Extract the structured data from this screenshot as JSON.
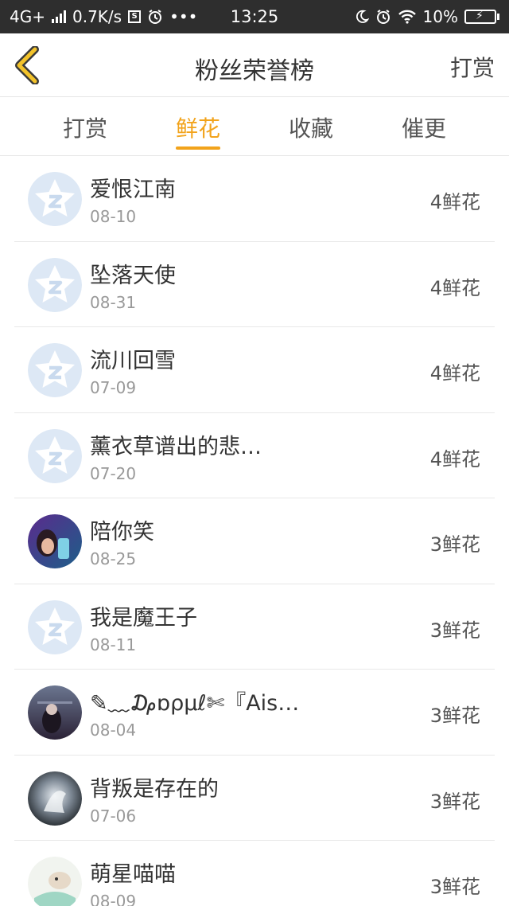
{
  "status_bar": {
    "network": "4G+",
    "speed": "0.7K/s",
    "time": "13:25",
    "battery": "10%",
    "icons": [
      "signal-icon",
      "s-box-icon",
      "alarm-icon",
      "more-icon",
      "moon-icon",
      "alarm-icon",
      "wifi-icon",
      "battery-icon"
    ]
  },
  "header": {
    "title": "粉丝荣誉榜",
    "back_icon": "chevron-left-icon",
    "right_action": "打赏"
  },
  "tabs": [
    {
      "label": "打赏",
      "active": false
    },
    {
      "label": "鲜花",
      "active": true
    },
    {
      "label": "收藏",
      "active": false
    },
    {
      "label": "催更",
      "active": false
    }
  ],
  "fans": [
    {
      "name": "爱恨江南",
      "date": "08-10",
      "amount": "4鲜花",
      "avatar": "default-avatar"
    },
    {
      "name": "坠落天使",
      "date": "08-31",
      "amount": "4鲜花",
      "avatar": "default-avatar"
    },
    {
      "name": "流川回雪",
      "date": "07-09",
      "amount": "4鲜花",
      "avatar": "default-avatar"
    },
    {
      "name": "薰衣草谱出的悲…",
      "date": "07-20",
      "amount": "4鲜花",
      "avatar": "default-avatar"
    },
    {
      "name": "陪你笑",
      "date": "08-25",
      "amount": "3鲜花",
      "avatar": "photo-avatar"
    },
    {
      "name": "我是魔王子",
      "date": "08-11",
      "amount": "3鲜花",
      "avatar": "default-avatar"
    },
    {
      "name": "✎﹏₯ɒρμℓ✄『Ais…",
      "date": "08-04",
      "amount": "3鲜花",
      "avatar": "photo-avatar"
    },
    {
      "name": "背叛是存在的",
      "date": "07-06",
      "amount": "3鲜花",
      "avatar": "photo-avatar"
    },
    {
      "name": "萌星喵喵",
      "date": "08-09",
      "amount": "3鲜花",
      "avatar": "photo-avatar"
    }
  ],
  "colors": {
    "accent": "#f2a31b",
    "status_bar_bg": "#2e2e2e",
    "default_avatar": "#dde8f5"
  }
}
